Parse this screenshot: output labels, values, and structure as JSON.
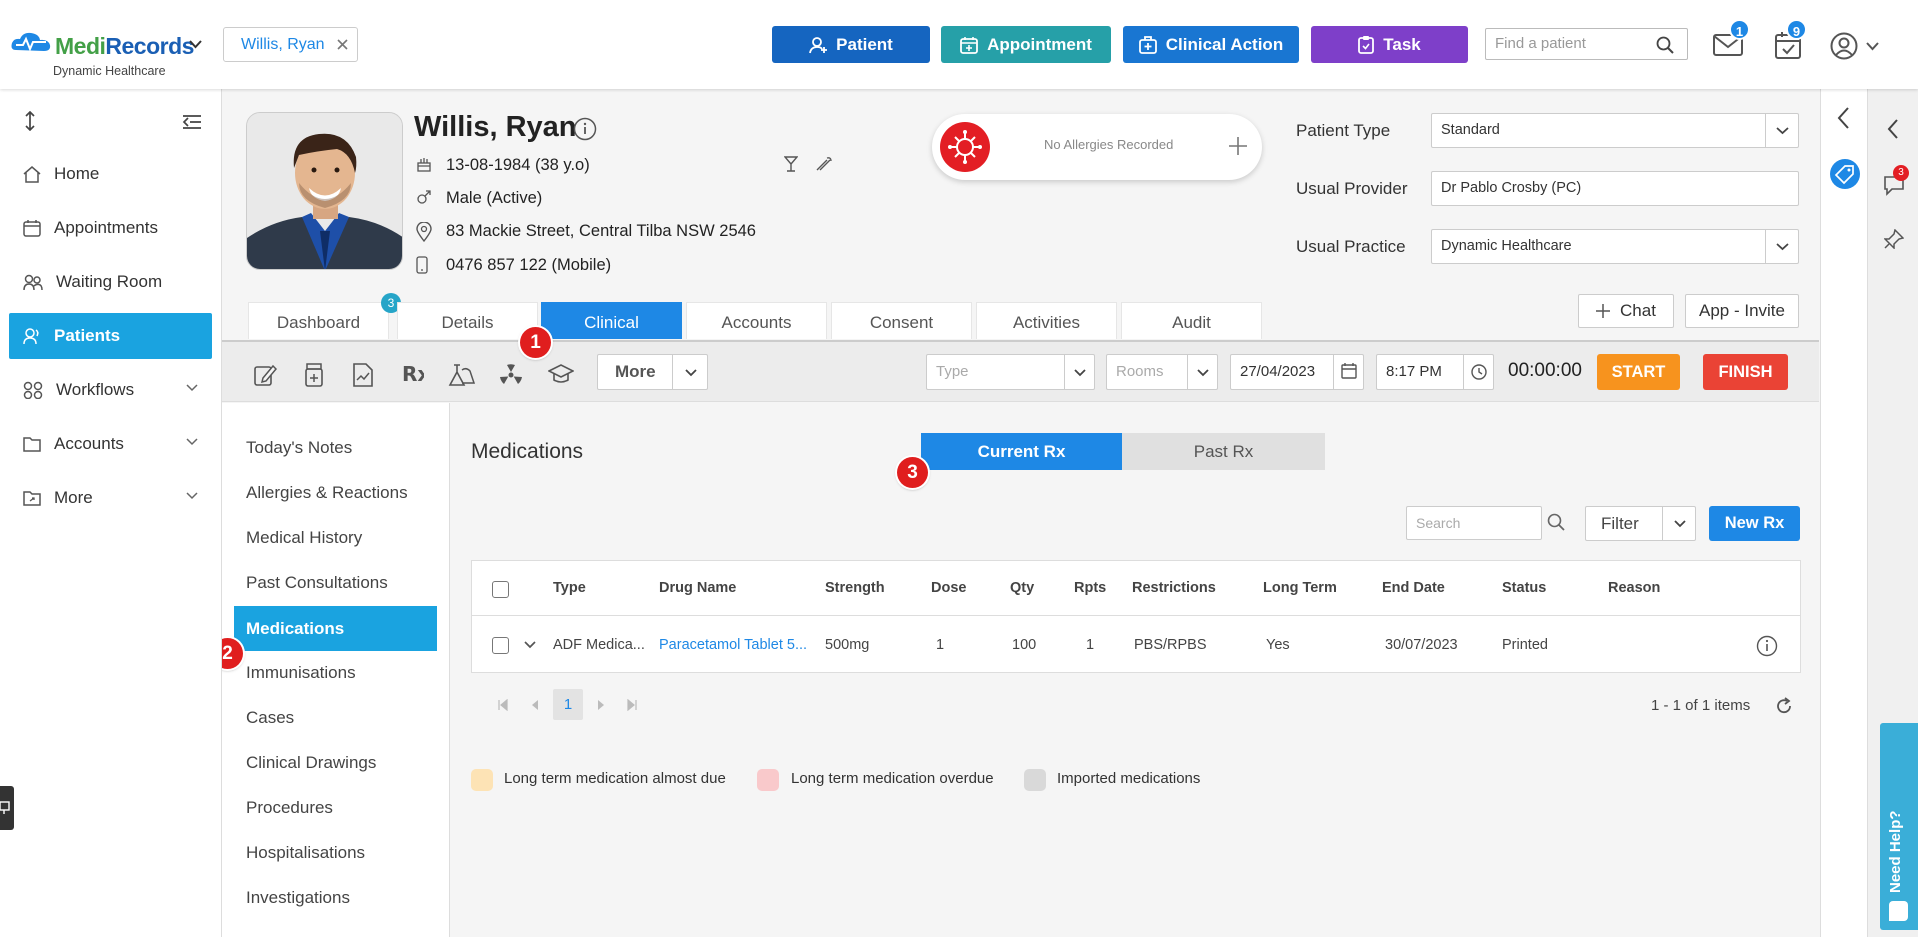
{
  "brand": {
    "name_part1": "Medi",
    "name_part2": "Records",
    "subtitle": "Dynamic Healthcare"
  },
  "patient_chip": {
    "label": "Willis, Ryan"
  },
  "top_buttons": [
    {
      "label": "Patient",
      "color": "#1565c0",
      "icon": "add-user-icon"
    },
    {
      "label": "Appointment",
      "color": "#26a0a8",
      "icon": "calendar-add-icon"
    },
    {
      "label": "Clinical Action",
      "color": "#1976d2",
      "icon": "medical-kit-icon"
    },
    {
      "label": "Task",
      "color": "#7e3fc9",
      "icon": "clipboard-icon"
    }
  ],
  "search": {
    "placeholder": "Find a patient"
  },
  "notifications": {
    "mail_count": "1",
    "tasks_count": "9"
  },
  "sidebar": {
    "items": [
      {
        "label": "Home",
        "icon": "home-icon"
      },
      {
        "label": "Appointments",
        "icon": "calendar-icon"
      },
      {
        "label": "Waiting Room",
        "icon": "people-icon"
      },
      {
        "label": "Patients",
        "icon": "patients-icon"
      },
      {
        "label": "Workflows",
        "icon": "workflow-icon"
      },
      {
        "label": "Accounts",
        "icon": "folder-icon"
      },
      {
        "label": "More",
        "icon": "folder-share-icon"
      }
    ]
  },
  "patient": {
    "name": "Willis, Ryan",
    "dob": "13-08-1984 (38 y.o)",
    "gender": "Male (Active)",
    "address": "83 Mackie Street, Central Tilba NSW 2546",
    "phone": "0476 857 122 (Mobile)",
    "allergy_text": "No Allergies Recorded",
    "patient_type_label": "Patient Type",
    "patient_type": "Standard",
    "usual_provider_label": "Usual Provider",
    "usual_provider": "Dr Pablo Crosby (PC)",
    "usual_practice_label": "Usual Practice",
    "usual_practice": "Dynamic Healthcare"
  },
  "tabs": [
    {
      "label": "Dashboard",
      "badge": "3"
    },
    {
      "label": "Details"
    },
    {
      "label": "Clinical"
    },
    {
      "label": "Accounts"
    },
    {
      "label": "Consent"
    },
    {
      "label": "Activities"
    },
    {
      "label": "Audit"
    }
  ],
  "header_actions": {
    "chat": "Chat",
    "invite": "App - Invite"
  },
  "toolbar": {
    "more": "More",
    "type_placeholder": "Type",
    "rooms_placeholder": "Rooms",
    "date": "27/04/2023",
    "time": "8:17 PM",
    "timer": "00:00:00",
    "start": "START",
    "finish": "FINISH"
  },
  "clinical_nav": [
    "Today's Notes",
    "Allergies & Reactions",
    "Medical History",
    "Past Consultations",
    "Medications",
    "Immunisations",
    "Cases",
    "Clinical Drawings",
    "Procedures",
    "Hospitalisations",
    "Investigations"
  ],
  "medications": {
    "title": "Medications",
    "current_rx": "Current Rx",
    "past_rx": "Past Rx",
    "search_placeholder": "Search",
    "filter": "Filter",
    "new_rx": "New Rx",
    "columns": [
      "Type",
      "Drug Name",
      "Strength",
      "Dose",
      "Qty",
      "Rpts",
      "Restrictions",
      "Long Term",
      "End Date",
      "Status",
      "Reason"
    ],
    "rows": [
      {
        "type": "ADF Medica...",
        "drug": "Paracetamol Tablet 5...",
        "strength": "500mg",
        "dose": "1",
        "qty": "100",
        "rpts": "1",
        "restrictions": "PBS/RPBS",
        "long_term": "Yes",
        "end_date": "30/07/2023",
        "status": "Printed",
        "reason": ""
      }
    ],
    "page": "1",
    "items_info": "1 - 1 of 1 items",
    "legend": [
      {
        "label": "Long term medication almost due",
        "color": "#fde3b5"
      },
      {
        "label": "Long term medication overdue",
        "color": "#f9c9cb"
      },
      {
        "label": "Imported medications",
        "color": "#d9d9d9"
      }
    ]
  },
  "step_markers": [
    "1",
    "2",
    "3"
  ],
  "chat_badge": "3",
  "help": {
    "label": "Need Help?"
  }
}
